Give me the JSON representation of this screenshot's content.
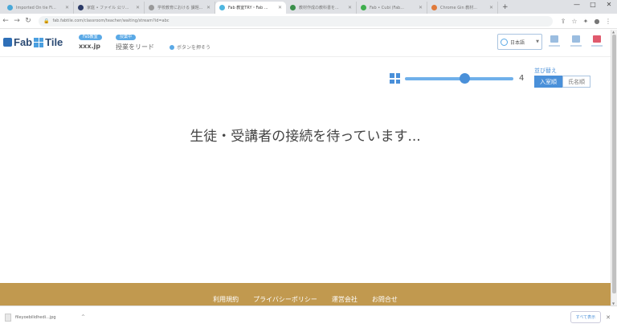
{
  "browser": {
    "tabs": [
      {
        "title": "Imported On tie Fi...",
        "color": "#4aa8d8",
        "active": false
      },
      {
        "title": "家庭 • ファイル 公リ...",
        "color": "#2b3a67",
        "active": false
      },
      {
        "title": "学校教育における 課題...",
        "color": "#999999",
        "active": false
      },
      {
        "title": "Fab 教室TRY・Fab ...",
        "color": "#4fb7e0",
        "active": true
      },
      {
        "title": "教材作成の教科書を...",
        "color": "#3a8f4a",
        "active": false
      },
      {
        "title": "Fab • Cubi (Fab...",
        "color": "#3fae4d",
        "active": false
      },
      {
        "title": "Chrome Gin 教材...",
        "color": "#e07a3a",
        "active": false
      }
    ],
    "url": "fab.fabtile.com/classroom/teacher/waiting/stream?id=abc",
    "window_controls": {
      "minimize": "—",
      "maximize": "□",
      "close": "✕"
    }
  },
  "header": {
    "logo": {
      "left": "Fab",
      "right": "Tile"
    },
    "items": [
      {
        "badge": "Fab教室",
        "text": "xxx.jp"
      },
      {
        "badge": "授業中",
        "text": "授業をリード"
      }
    ],
    "link": "ボタンを押そう",
    "language": "日本語"
  },
  "controls": {
    "student_count": "4",
    "slider_value": 0.55,
    "sort_label": "並び替え",
    "sort_options": [
      {
        "label": "入室順",
        "selected": true
      },
      {
        "label": "氏名順",
        "selected": false
      }
    ]
  },
  "main": {
    "waiting_message": "生徒・受講者の接続を待っています..."
  },
  "footer": {
    "links": [
      "利用規約",
      "プライバシーポリシー",
      "運営会社",
      "お問合せ"
    ]
  },
  "downloads": {
    "file_name": "fileyoebilidhedi...jpg",
    "show_all": "すべて表示"
  }
}
